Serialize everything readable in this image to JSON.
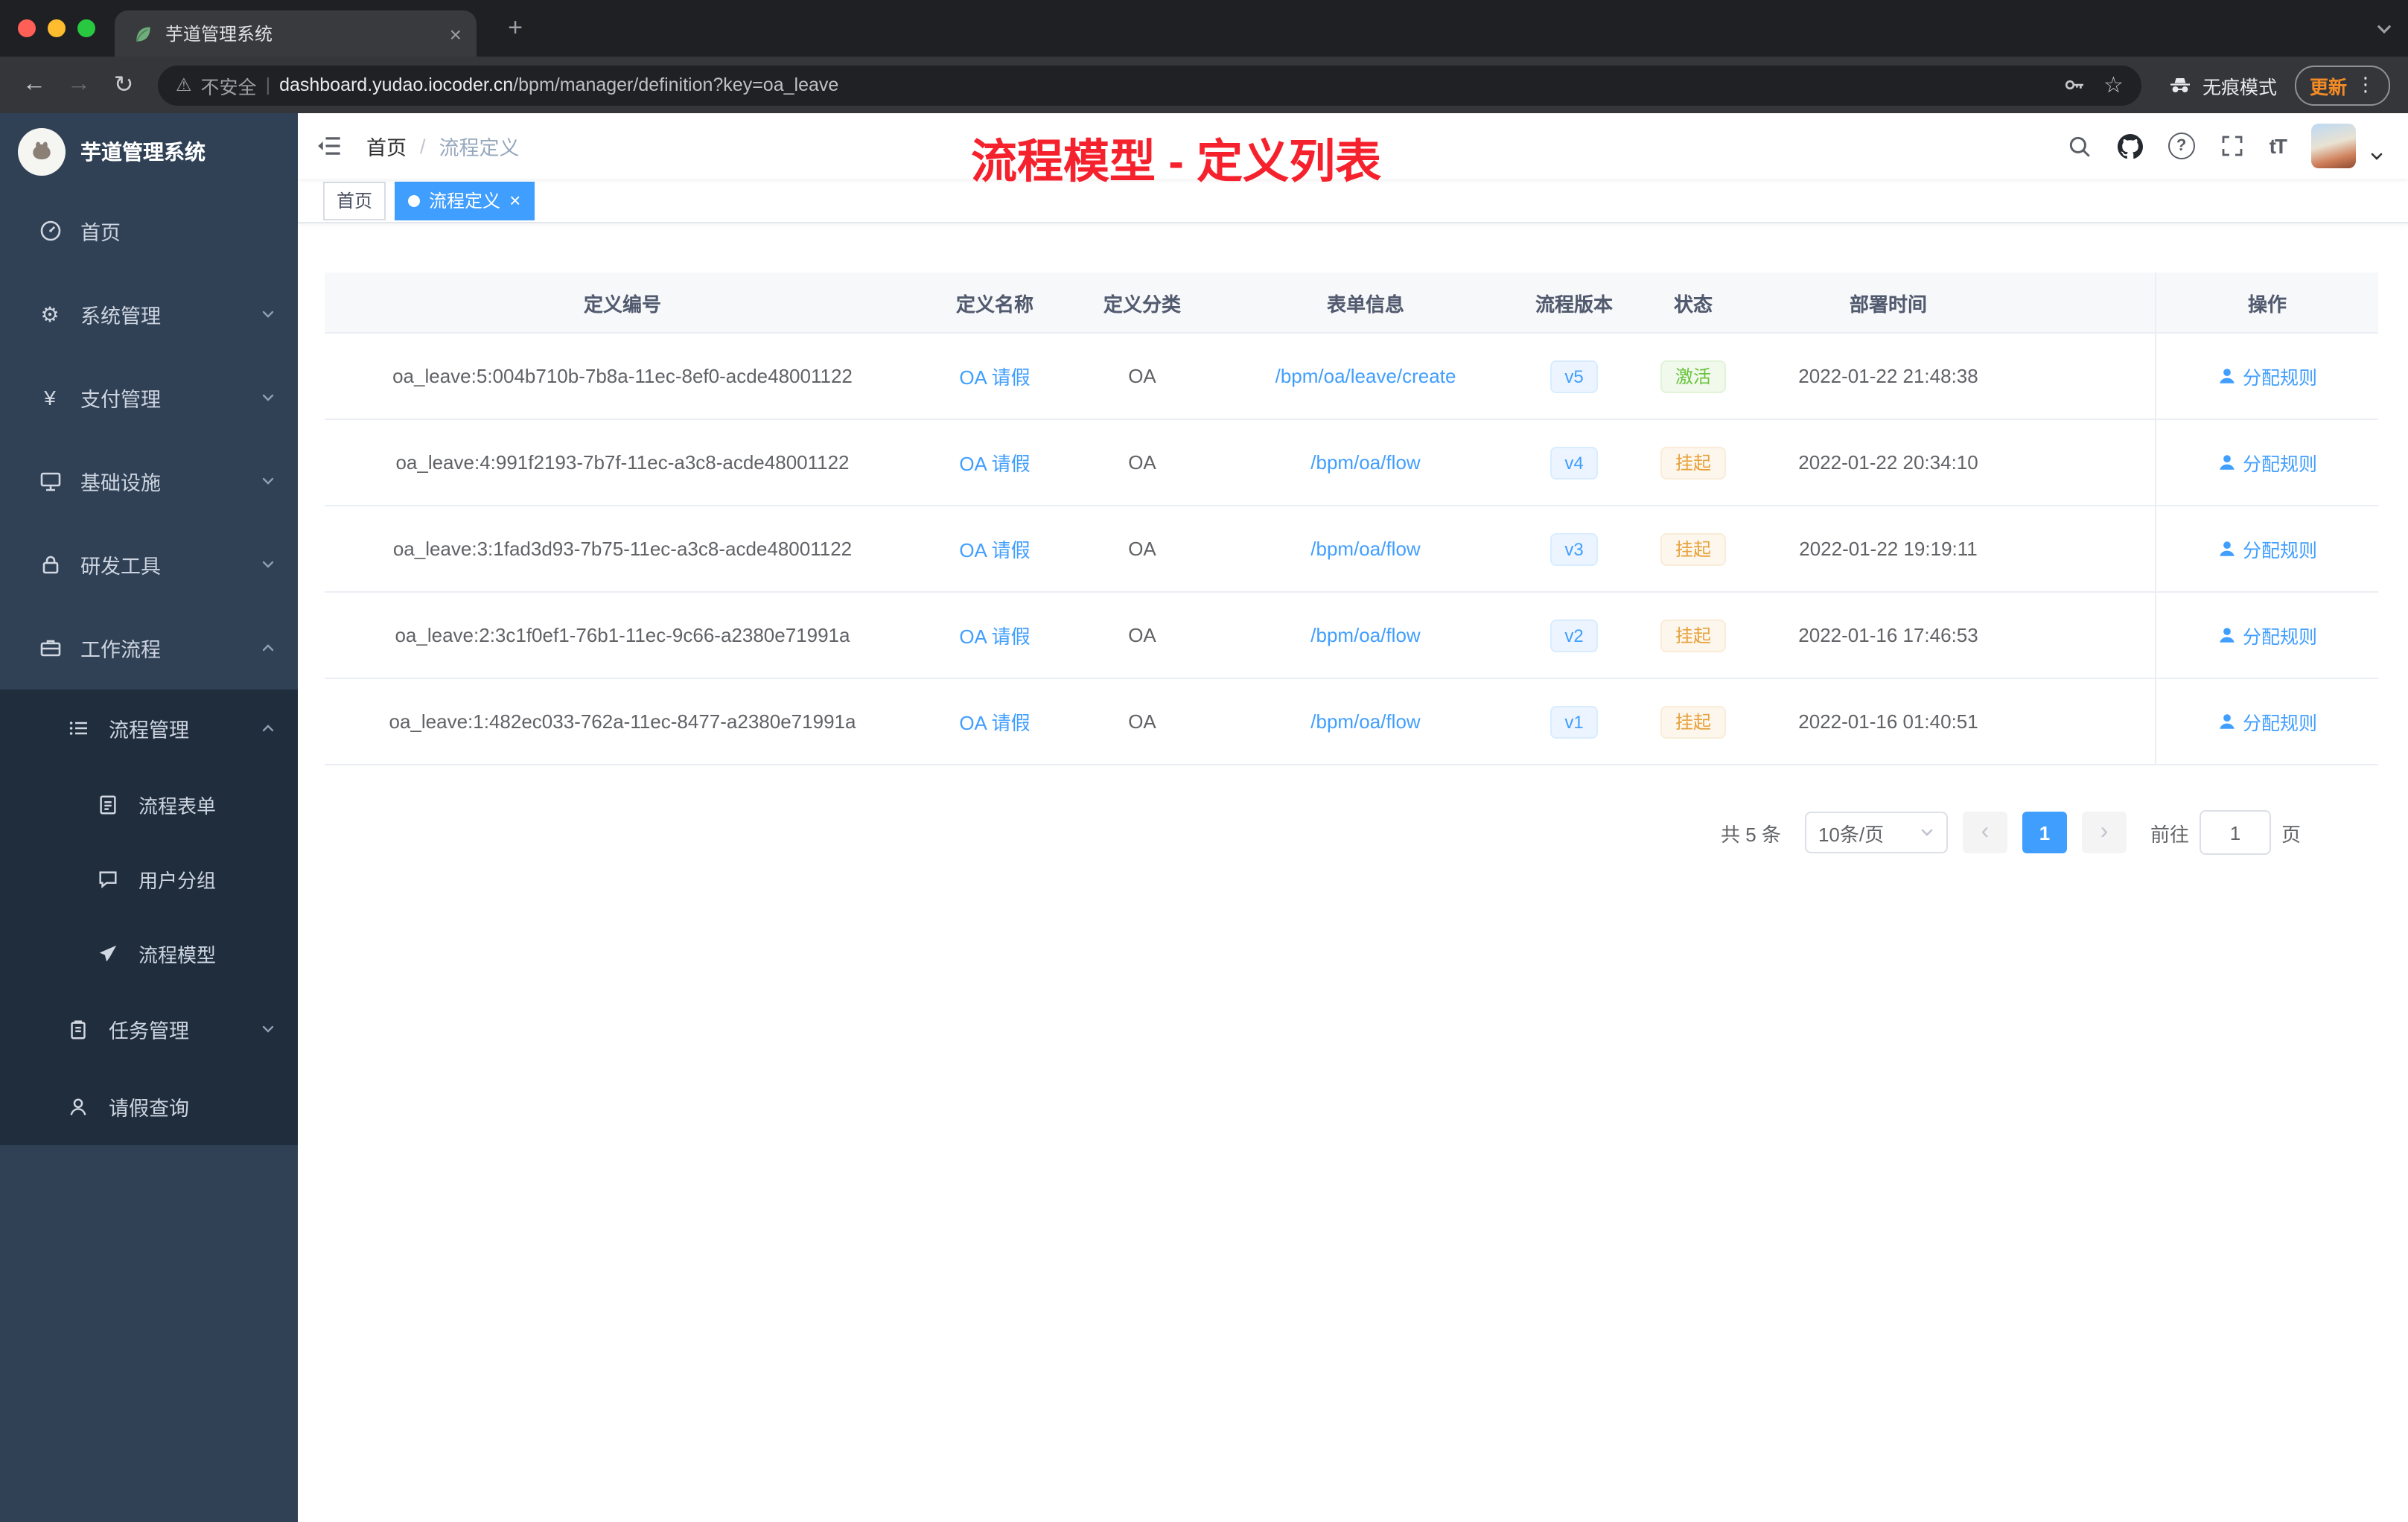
{
  "icons": {
    "back": "←",
    "forward": "→",
    "reload": "↻",
    "warning": "⚠",
    "star": "☆",
    "menu_dots": "⋮",
    "new_tab": "+",
    "close": "×",
    "gear": "⚙",
    "yen": "¥",
    "question": "?",
    "font_size": "tT",
    "divider": "|",
    "prev": "‹",
    "next": "›"
  },
  "browser": {
    "tab_title": "芋道管理系统",
    "security_label": "不安全",
    "url_domain": "dashboard.yudao.iocoder.cn",
    "url_path": "/bpm/manager/definition?key=oa_leave",
    "incognito_label": "无痕模式",
    "update_label": "更新"
  },
  "app": {
    "logo_title": "芋道管理系统",
    "breadcrumb": {
      "home": "首页",
      "separator": "/",
      "current": "流程定义"
    },
    "annotation": "流程模型 - 定义列表",
    "tags": {
      "home": "首页",
      "active": "流程定义"
    }
  },
  "sidebar": {
    "items": [
      {
        "label": "首页"
      },
      {
        "label": "系统管理"
      },
      {
        "label": "支付管理"
      },
      {
        "label": "基础设施"
      },
      {
        "label": "研发工具"
      },
      {
        "label": "工作流程"
      },
      {
        "label": "流程管理"
      },
      {
        "label": "流程表单"
      },
      {
        "label": "用户分组"
      },
      {
        "label": "流程模型"
      },
      {
        "label": "任务管理"
      },
      {
        "label": "请假查询"
      }
    ]
  },
  "table": {
    "columns": [
      "定义编号",
      "定义名称",
      "定义分类",
      "表单信息",
      "流程版本",
      "状态",
      "部署时间",
      "操作"
    ],
    "rows": [
      {
        "id": "oa_leave:5:004b710b-7b8a-11ec-8ef0-acde48001122",
        "name": "OA 请假",
        "category": "OA",
        "form": "/bpm/oa/leave/create",
        "version": "v5",
        "status": "激活",
        "status_type": "success",
        "deploy_time": "2022-01-22 21:48:38",
        "action": "分配规则"
      },
      {
        "id": "oa_leave:4:991f2193-7b7f-11ec-a3c8-acde48001122",
        "name": "OA 请假",
        "category": "OA",
        "form": "/bpm/oa/flow",
        "version": "v4",
        "status": "挂起",
        "status_type": "warning",
        "deploy_time": "2022-01-22 20:34:10",
        "action": "分配规则"
      },
      {
        "id": "oa_leave:3:1fad3d93-7b75-11ec-a3c8-acde48001122",
        "name": "OA 请假",
        "category": "OA",
        "form": "/bpm/oa/flow",
        "version": "v3",
        "status": "挂起",
        "status_type": "warning",
        "deploy_time": "2022-01-22 19:19:11",
        "action": "分配规则"
      },
      {
        "id": "oa_leave:2:3c1f0ef1-76b1-11ec-9c66-a2380e71991a",
        "name": "OA 请假",
        "category": "OA",
        "form": "/bpm/oa/flow",
        "version": "v2",
        "status": "挂起",
        "status_type": "warning",
        "deploy_time": "2022-01-16 17:46:53",
        "action": "分配规则"
      },
      {
        "id": "oa_leave:1:482ec033-762a-11ec-8477-a2380e71991a",
        "name": "OA 请假",
        "category": "OA",
        "form": "/bpm/oa/flow",
        "version": "v1",
        "status": "挂起",
        "status_type": "warning",
        "deploy_time": "2022-01-16 01:40:51",
        "action": "分配规则"
      }
    ]
  },
  "pagination": {
    "total": "共 5 条",
    "page_size": "10条/页",
    "page": "1",
    "goto": "前往",
    "goto_value": "1",
    "unit": "页"
  },
  "colors": {
    "accent": "#409eff",
    "success": "#67c23a",
    "warning": "#e6a23c",
    "annotation_red": "#f5222d",
    "sidebar_bg": "#304156",
    "submenu_bg": "#1f2d3d"
  }
}
